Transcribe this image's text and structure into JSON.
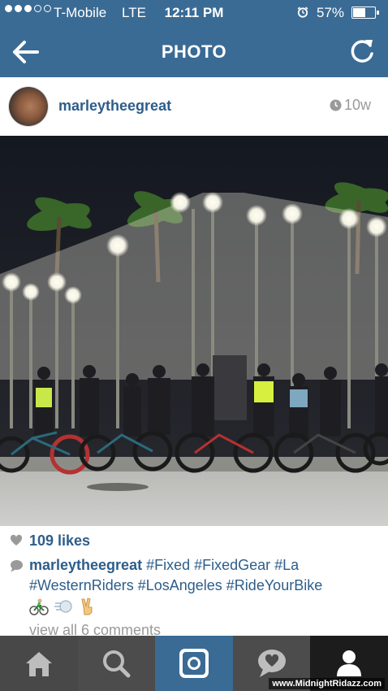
{
  "status_bar": {
    "carrier": "T-Mobile",
    "network": "LTE",
    "time": "12:11 PM",
    "battery": "57%",
    "battery_level": 0.57,
    "signal_bars": 3,
    "icons": [
      "signal-dots",
      "alarm-clock-icon",
      "battery-icon"
    ]
  },
  "nav": {
    "title": "PHOTO",
    "back_icon": "arrow-left-icon",
    "refresh_icon": "refresh-icon"
  },
  "post": {
    "username": "marleytheegreat",
    "age": "10w",
    "likes": "109 likes",
    "caption_user": "marleytheegreat",
    "caption_text": "#Fixed #FixedGear #La #WesternRiders #LosAngeles #RideYourBike",
    "emojis": [
      "cyclist-emoji",
      "dash-emoji",
      "victory-hand-emoji"
    ],
    "view_comments": "view all 6 comments"
  },
  "tabs": [
    {
      "name": "home",
      "icon": "home-icon"
    },
    {
      "name": "explore",
      "icon": "search-icon"
    },
    {
      "name": "camera",
      "icon": "camera-icon"
    },
    {
      "name": "activity",
      "icon": "activity-icon"
    },
    {
      "name": "profile",
      "icon": "profile-icon"
    }
  ],
  "watermark": "www.MidnightRidazz.com",
  "colors": {
    "header_blue": "#3a6b95",
    "link_blue": "#2d5e8a",
    "muted_gray": "#9a9a9a",
    "tab_bar": "#444444"
  }
}
